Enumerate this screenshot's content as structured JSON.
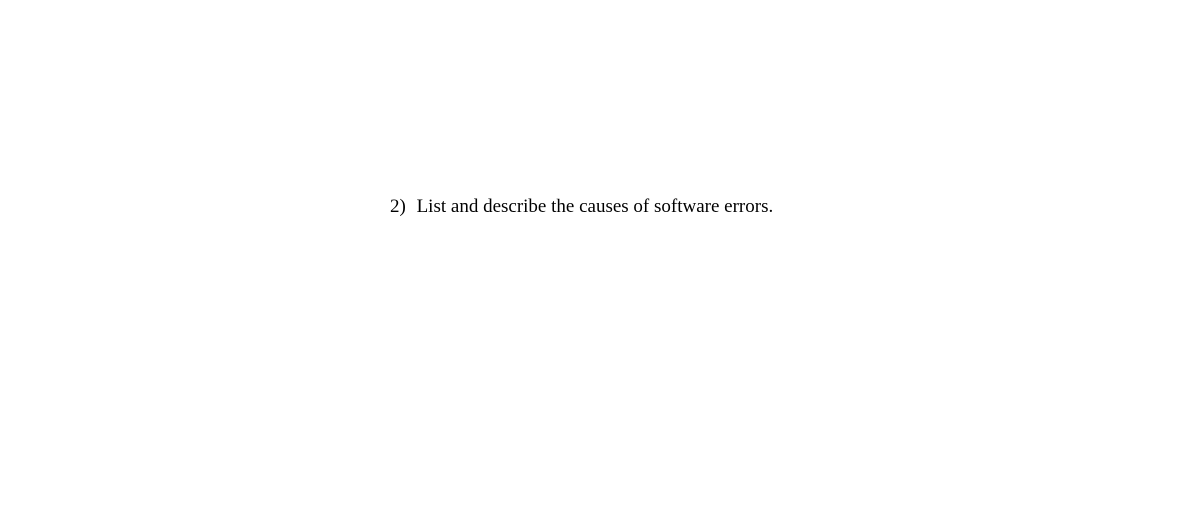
{
  "question": {
    "number": "2)",
    "text": "List and describe the causes of software errors."
  }
}
